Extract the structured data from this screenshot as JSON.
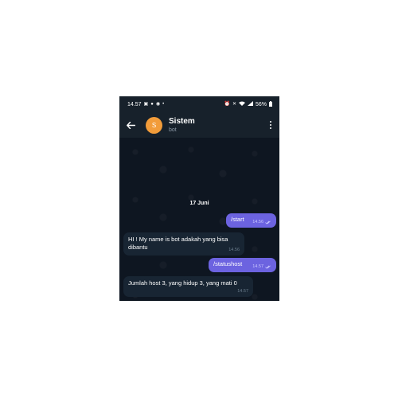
{
  "status_bar": {
    "time": "14.57",
    "battery": "56%",
    "left_icons": [
      "image-icon",
      "bulb-icon",
      "facebook-icon",
      "dot-icon"
    ],
    "right_icons": [
      "alarm-icon",
      "mute-icon",
      "wifi-icon",
      "signal-icon",
      "battery-icon"
    ]
  },
  "header": {
    "avatar_letter": "S",
    "avatar_color": "#f29c3a",
    "title": "Sistem",
    "subtitle": "bot"
  },
  "chat": {
    "date_chip": "17 Juni",
    "messages": [
      {
        "direction": "out",
        "text": "/start",
        "time": "14.56",
        "read": true
      },
      {
        "direction": "in",
        "text_line1": "HI ! My name is bot adakah yang bisa",
        "text_line2": "dibantu",
        "time": "14.56"
      },
      {
        "direction": "out",
        "text": "/statushost",
        "time": "14.57",
        "read": true
      },
      {
        "direction": "in",
        "text": "Jumlah host 3, yang hidup 3, yang mati 0",
        "time": "14.57"
      }
    ]
  },
  "colors": {
    "background": "#0e1621",
    "header": "#17212b",
    "outgoing_bubble": "#6c63e0",
    "incoming_bubble": "#182533"
  }
}
